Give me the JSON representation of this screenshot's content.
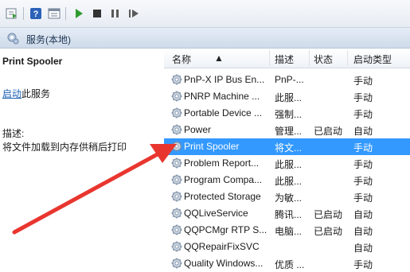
{
  "header": {
    "title": "服务(本地)"
  },
  "detail": {
    "service_name": "Print Spooler",
    "start_link": "启动",
    "start_suffix": "此服务",
    "desc_label": "描述:",
    "desc_text": "将文件加载到内存供稍后打印"
  },
  "columns": {
    "name": "名称",
    "desc": "描述",
    "status": "状态",
    "type": "启动类型"
  },
  "rows": [
    {
      "name": "PnP-X IP Bus En...",
      "desc": "PnP-...",
      "status": "",
      "type": "手动"
    },
    {
      "name": "PNRP Machine ...",
      "desc": "此服...",
      "status": "",
      "type": "手动"
    },
    {
      "name": "Portable Device ...",
      "desc": "强制...",
      "status": "",
      "type": "手动"
    },
    {
      "name": "Power",
      "desc": "管理...",
      "status": "已启动",
      "type": "自动"
    },
    {
      "name": "Print Spooler",
      "desc": "将文...",
      "status": "",
      "type": "手动"
    },
    {
      "name": "Problem Report...",
      "desc": "此服...",
      "status": "",
      "type": "手动"
    },
    {
      "name": "Program Compa...",
      "desc": "此服...",
      "status": "",
      "type": "手动"
    },
    {
      "name": "Protected Storage",
      "desc": "为敏...",
      "status": "",
      "type": "手动"
    },
    {
      "name": "QQLiveService",
      "desc": "腾讯...",
      "status": "已启动",
      "type": "自动"
    },
    {
      "name": "QQPCMgr RTP S...",
      "desc": "电脑...",
      "status": "已启动",
      "type": "自动"
    },
    {
      "name": "QQRepairFixSVC",
      "desc": "",
      "status": "",
      "type": "自动"
    },
    {
      "name": "Quality Windows...",
      "desc": "优质 ...",
      "status": "",
      "type": "手动"
    }
  ],
  "selected_index": 4,
  "icons": {
    "toolbar": [
      "export-list-icon",
      "help-icon",
      "properties-icon",
      "start-icon",
      "stop-icon",
      "pause-icon",
      "restart-icon"
    ],
    "row": "gear-icon",
    "header": "services-icon"
  },
  "colors": {
    "selection": "#3399ff",
    "annotation_arrow": "#e8362f",
    "link": "#1a5fb4"
  }
}
